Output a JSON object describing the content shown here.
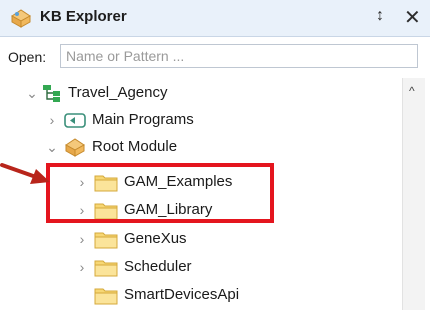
{
  "window": {
    "title": "KB Explorer",
    "pin_glyph": "↕",
    "close_glyph": "✕"
  },
  "open": {
    "label": "Open:",
    "placeholder": "Name or Pattern ..."
  },
  "tree": {
    "items": [
      {
        "label": "Travel_Agency",
        "expanded": true,
        "icon": "kb-root-icon"
      },
      {
        "label": "Main Programs",
        "expanded": false,
        "icon": "main-programs-icon"
      },
      {
        "label": "Root Module",
        "expanded": true,
        "icon": "module-icon"
      },
      {
        "label": "GAM_Examples",
        "expanded": false,
        "icon": "folder-icon"
      },
      {
        "label": "GAM_Library",
        "expanded": false,
        "icon": "folder-icon"
      },
      {
        "label": "GeneXus",
        "expanded": false,
        "icon": "folder-icon"
      },
      {
        "label": "Scheduler",
        "expanded": false,
        "icon": "folder-icon"
      },
      {
        "label": "SmartDevicesApi",
        "expanded": false,
        "icon": "folder-icon"
      }
    ]
  },
  "annotation": {
    "highlight_color": "#e4151e",
    "arrow_color": "#b8251b"
  },
  "colors": {
    "titlebar": "#e9f1fa",
    "folder": "#f7d774"
  }
}
